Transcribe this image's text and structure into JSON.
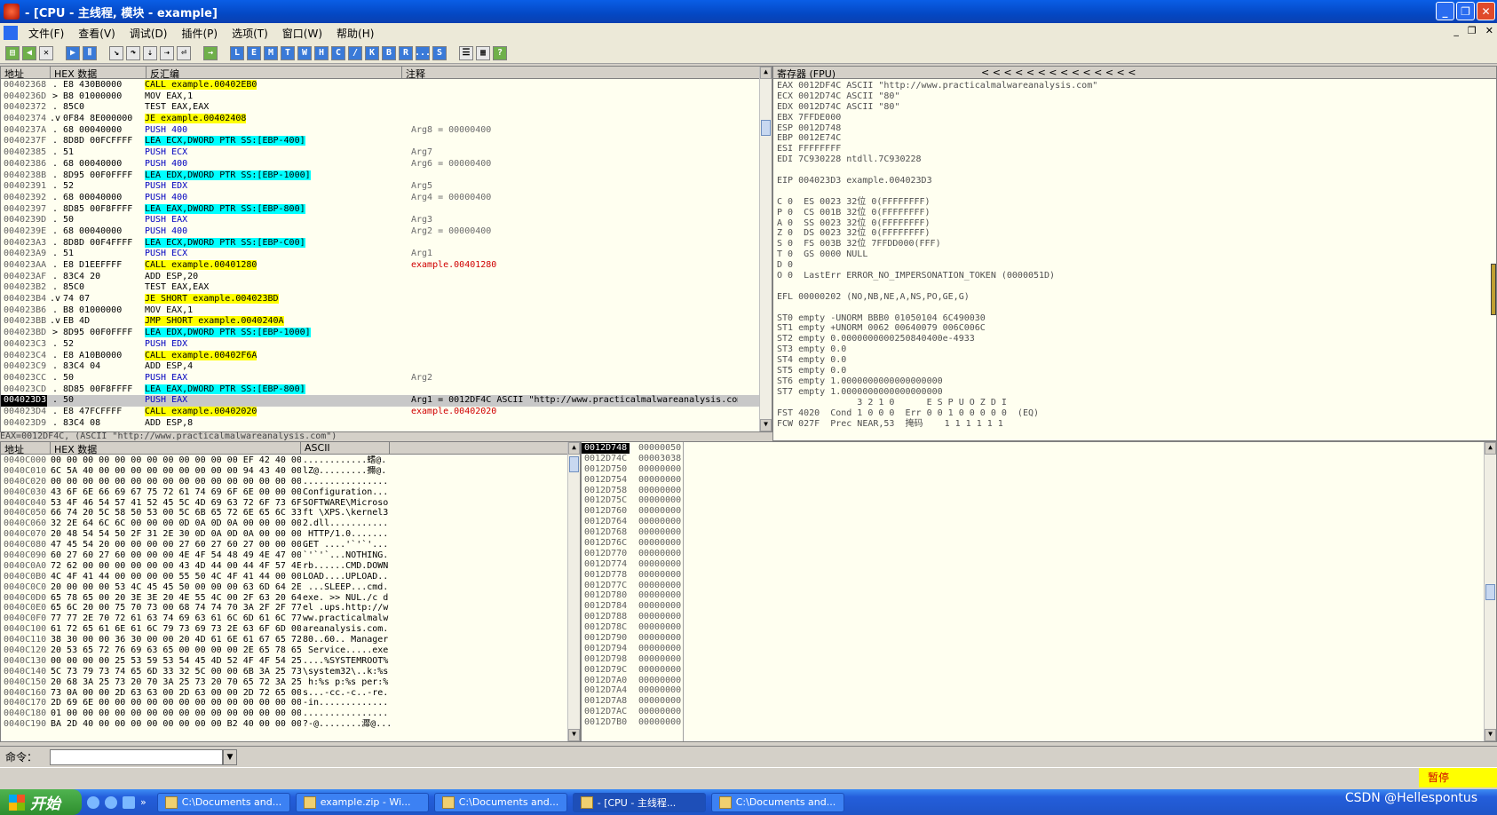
{
  "window": {
    "title": "- [CPU - 主线程, 模块 - example]"
  },
  "menu": [
    "文件(F)",
    "查看(V)",
    "调试(D)",
    "插件(P)",
    "选项(T)",
    "窗口(W)",
    "帮助(H)"
  ],
  "toolbar": [
    "L",
    "E",
    "M",
    "T",
    "W",
    "H",
    "C",
    "/",
    "K",
    "B",
    "R",
    "...",
    "S"
  ],
  "disasm": {
    "headers": {
      "addr": "地址",
      "hex": "HEX 数据",
      "asm": "反汇编",
      "comment": "注释"
    },
    "rows": [
      {
        "a": "00402368",
        "m": ".",
        "h": "E8 430B0000",
        "i": "CALL example.00402EB0",
        "hl": "y",
        "c": ""
      },
      {
        "a": "0040236D",
        "m": ">",
        "h": "B8 01000000",
        "i": "MOV EAX,1",
        "hl": "",
        "c": ""
      },
      {
        "a": "00402372",
        "m": ".",
        "h": "85C0",
        "i": "TEST EAX,EAX",
        "hl": "",
        "c": ""
      },
      {
        "a": "00402374",
        "m": ".v",
        "h": "0F84 8E000000",
        "i": "JE example.00402408",
        "hl": "y",
        "c": ""
      },
      {
        "a": "0040237A",
        "m": ".",
        "h": "68 00040000",
        "i": "PUSH 400",
        "hl": "p",
        "c": "Arg8 = 00000400"
      },
      {
        "a": "0040237F",
        "m": ".",
        "h": "8D8D 00FCFFFF",
        "i": "LEA ECX,DWORD PTR SS:[EBP-400]",
        "hl": "c",
        "c": ""
      },
      {
        "a": "00402385",
        "m": ".",
        "h": "51",
        "i": "PUSH ECX",
        "hl": "p",
        "c": "Arg7"
      },
      {
        "a": "00402386",
        "m": ".",
        "h": "68 00040000",
        "i": "PUSH 400",
        "hl": "p",
        "c": "Arg6 = 00000400"
      },
      {
        "a": "0040238B",
        "m": ".",
        "h": "8D95 00F0FFFF",
        "i": "LEA EDX,DWORD PTR SS:[EBP-1000]",
        "hl": "c",
        "c": ""
      },
      {
        "a": "00402391",
        "m": ".",
        "h": "52",
        "i": "PUSH EDX",
        "hl": "p",
        "c": "Arg5"
      },
      {
        "a": "00402392",
        "m": ".",
        "h": "68 00040000",
        "i": "PUSH 400",
        "hl": "p",
        "c": "Arg4 = 00000400"
      },
      {
        "a": "00402397",
        "m": ".",
        "h": "8D85 00F8FFFF",
        "i": "LEA EAX,DWORD PTR SS:[EBP-800]",
        "hl": "c",
        "c": ""
      },
      {
        "a": "0040239D",
        "m": ".",
        "h": "50",
        "i": "PUSH EAX",
        "hl": "p",
        "c": "Arg3"
      },
      {
        "a": "0040239E",
        "m": ".",
        "h": "68 00040000",
        "i": "PUSH 400",
        "hl": "p",
        "c": "Arg2 = 00000400"
      },
      {
        "a": "004023A3",
        "m": ".",
        "h": "8D8D 00F4FFFF",
        "i": "LEA ECX,DWORD PTR SS:[EBP-C00]",
        "hl": "c",
        "c": ""
      },
      {
        "a": "004023A9",
        "m": ".",
        "h": "51",
        "i": "PUSH ECX",
        "hl": "p",
        "c": "Arg1"
      },
      {
        "a": "004023AA",
        "m": ".",
        "h": "E8 D1EEFFFF",
        "i": "CALL example.00401280",
        "hl": "y",
        "c": "example.00401280"
      },
      {
        "a": "004023AF",
        "m": ".",
        "h": "83C4 20",
        "i": "ADD ESP,20",
        "hl": "",
        "c": ""
      },
      {
        "a": "004023B2",
        "m": ".",
        "h": "85C0",
        "i": "TEST EAX,EAX",
        "hl": "",
        "c": ""
      },
      {
        "a": "004023B4",
        "m": ".v",
        "h": "74 07",
        "i": "JE SHORT example.004023BD",
        "hl": "y",
        "c": ""
      },
      {
        "a": "004023B6",
        "m": ".",
        "h": "B8 01000000",
        "i": "MOV EAX,1",
        "hl": "",
        "c": ""
      },
      {
        "a": "004023BB",
        "m": ".v",
        "h": "EB 4D",
        "i": "JMP SHORT example.0040240A",
        "hl": "y",
        "c": ""
      },
      {
        "a": "004023BD",
        "m": ">",
        "h": "8D95 00F0FFFF",
        "i": "LEA EDX,DWORD PTR SS:[EBP-1000]",
        "hl": "c",
        "c": ""
      },
      {
        "a": "004023C3",
        "m": ".",
        "h": "52",
        "i": "PUSH EDX",
        "hl": "p",
        "c": ""
      },
      {
        "a": "004023C4",
        "m": ".",
        "h": "E8 A10B0000",
        "i": "CALL example.00402F6A",
        "hl": "y",
        "c": ""
      },
      {
        "a": "004023C9",
        "m": ".",
        "h": "83C4 04",
        "i": "ADD ESP,4",
        "hl": "",
        "c": ""
      },
      {
        "a": "004023CC",
        "m": ".",
        "h": "50",
        "i": "PUSH EAX",
        "hl": "p",
        "c": "Arg2"
      },
      {
        "a": "004023CD",
        "m": ".",
        "h": "8D85 00F8FFFF",
        "i": "LEA EAX,DWORD PTR SS:[EBP-800]",
        "hl": "c",
        "c": ""
      },
      {
        "a": "004023D3",
        "m": ".",
        "h": "50",
        "i": "PUSH EAX",
        "hl": "p",
        "c": "Arg1 = 0012DF4C ASCII \"http://www.practicalmalwareanalysis.com\"",
        "cur": true
      },
      {
        "a": "004023D4",
        "m": ".",
        "h": "E8 47FCFFFF",
        "i": "CALL example.00402020",
        "hl": "y",
        "c": "example.00402020"
      },
      {
        "a": "004023D9",
        "m": ".",
        "h": "83C4 08",
        "i": "ADD ESP,8",
        "hl": "",
        "c": ""
      }
    ],
    "info": "EAX=0012DF4C, (ASCII \"http://www.practicalmalwareanalysis.com\")"
  },
  "registers": {
    "header": "寄存器 (FPU)",
    "arrows": "< < < < < < < < < < < < < <",
    "lines": [
      {
        "t": "EAX 0012DF4C ASCII \"http://www.practicalmalwareanalysis.com\"",
        "r": true
      },
      {
        "t": "ECX 0012D74C ASCII \"80\"",
        "r": false
      },
      {
        "t": "EDX 0012D74C ASCII \"80\"",
        "r": false
      },
      {
        "t": "EBX 7FFDE000",
        "r": false
      },
      {
        "t": "ESP 0012D748",
        "r": false
      },
      {
        "t": "EBP 0012E74C",
        "r": false
      },
      {
        "t": "ESI FFFFFFFF",
        "r": false
      },
      {
        "t": "EDI 7C930228 ntdll.7C930228",
        "r": false
      },
      {
        "t": "",
        "r": false
      },
      {
        "t": "EIP 004023D3 example.004023D3",
        "r": true
      },
      {
        "t": "",
        "r": false
      },
      {
        "t": "C 0  ES 0023 32位 0(FFFFFFFF)",
        "r": false
      },
      {
        "t": "P 0  CS 001B 32位 0(FFFFFFFF)",
        "r": false
      },
      {
        "t": "A 0  SS 0023 32位 0(FFFFFFFF)",
        "r": false
      },
      {
        "t": "Z 0  DS 0023 32位 0(FFFFFFFF)",
        "r": false
      },
      {
        "t": "S 0  FS 003B 32位 7FFDD000(FFF)",
        "r": false
      },
      {
        "t": "T 0  GS 0000 NULL",
        "r": false
      },
      {
        "t": "D 0",
        "r": false
      },
      {
        "t": "O 0  LastErr ERROR_NO_IMPERSONATION_TOKEN (0000051D)",
        "r": false
      },
      {
        "t": "",
        "r": false
      },
      {
        "t": "EFL 00000202 (NO,NB,NE,A,NS,PO,GE,G)",
        "r": false
      },
      {
        "t": "",
        "r": false
      },
      {
        "t": "ST0 empty -UNORM BBB0 01050104 6C490030",
        "r": false
      },
      {
        "t": "ST1 empty +UNORM 0062 00640079 006C006C",
        "r": false
      },
      {
        "t": "ST2 empty 0.0000000000250840400e-4933",
        "r": false
      },
      {
        "t": "ST3 empty 0.0",
        "r": false
      },
      {
        "t": "ST4 empty 0.0",
        "r": false
      },
      {
        "t": "ST5 empty 0.0",
        "r": false
      },
      {
        "t": "ST6 empty 1.0000000000000000000",
        "r": false
      },
      {
        "t": "ST7 empty 1.0000000000000000000",
        "r": false
      },
      {
        "t": "               3 2 1 0      E S P U O Z D I",
        "r": false
      },
      {
        "t": "FST 4020  Cond 1 0 0 0  Err 0 0 1 0 0 0 0 0  (EQ)",
        "r": false
      },
      {
        "t": "FCW 027F  Prec NEAR,53  掩码    1 1 1 1 1 1",
        "r": false
      }
    ]
  },
  "dump": {
    "headers": {
      "addr": "地址",
      "hex": "HEX 数据",
      "ascii": "ASCII"
    },
    "rows": [
      {
        "a": "0040C000",
        "h": "00 00 00 00 00 00 00 00 00 00 00 00 EF 42 40 00",
        "s": "............螧@."
      },
      {
        "a": "0040C010",
        "h": "6C 5A 40 00 00 00 00 00 00 00 00 00 94 43 40 00",
        "s": "lZ@.........擟@."
      },
      {
        "a": "0040C020",
        "h": "00 00 00 00 00 00 00 00 00 00 00 00 00 00 00 00",
        "s": "................"
      },
      {
        "a": "0040C030",
        "h": "43 6F 6E 66 69 67 75 72 61 74 69 6F 6E 00 00 00",
        "s": "Configuration..."
      },
      {
        "a": "0040C040",
        "h": "53 4F 46 54 57 41 52 45 5C 4D 69 63 72 6F 73 6F",
        "s": "SOFTWARE\\Microso"
      },
      {
        "a": "0040C050",
        "h": "66 74 20 5C 58 50 53 00 5C 6B 65 72 6E 65 6C 33",
        "s": "ft \\XPS.\\kernel3"
      },
      {
        "a": "0040C060",
        "h": "32 2E 64 6C 6C 00 00 00 0D 0A 0D 0A 00 00 00 00",
        "s": "2.dll..........."
      },
      {
        "a": "0040C070",
        "h": "20 48 54 54 50 2F 31 2E 30 0D 0A 0D 0A 00 00 00",
        "s": " HTTP/1.0......."
      },
      {
        "a": "0040C080",
        "h": "47 45 54 20 00 00 00 00 27 60 27 60 27 00 00 00",
        "s": "GET ....'`'`'..."
      },
      {
        "a": "0040C090",
        "h": "60 27 60 27 60 00 00 00 4E 4F 54 48 49 4E 47 00",
        "s": "`'`'`...NOTHING."
      },
      {
        "a": "0040C0A0",
        "h": "72 62 00 00 00 00 00 00 43 4D 44 00 44 4F 57 4E",
        "s": "rb......CMD.DOWN"
      },
      {
        "a": "0040C0B0",
        "h": "4C 4F 41 44 00 00 00 00 55 50 4C 4F 41 44 00 00",
        "s": "LOAD....UPLOAD.."
      },
      {
        "a": "0040C0C0",
        "h": "20 00 00 00 53 4C 45 45 50 00 00 00 63 6D 64 2E",
        "s": " ...SLEEP...cmd."
      },
      {
        "a": "0040C0D0",
        "h": "65 78 65 00 20 3E 3E 20 4E 55 4C 00 2F 63 20 64",
        "s": "exe. >> NUL./c d"
      },
      {
        "a": "0040C0E0",
        "h": "65 6C 20 00 75 70 73 00 68 74 74 70 3A 2F 2F 77",
        "s": "el .ups.http://w"
      },
      {
        "a": "0040C0F0",
        "h": "77 77 2E 70 72 61 63 74 69 63 61 6C 6D 61 6C 77",
        "s": "ww.practicalmalw"
      },
      {
        "a": "0040C100",
        "h": "61 72 65 61 6E 61 6C 79 73 69 73 2E 63 6F 6D 00",
        "s": "areanalysis.com."
      },
      {
        "a": "0040C110",
        "h": "38 30 00 00 36 30 00 00 20 4D 61 6E 61 67 65 72",
        "s": "80..60.. Manager"
      },
      {
        "a": "0040C120",
        "h": "20 53 65 72 76 69 63 65 00 00 00 00 2E 65 78 65",
        "s": " Service.....exe"
      },
      {
        "a": "0040C130",
        "h": "00 00 00 00 25 53 59 53 54 45 4D 52 4F 4F 54 25",
        "s": "....%SYSTEMROOT%"
      },
      {
        "a": "0040C140",
        "h": "5C 73 79 73 74 65 6D 33 32 5C 00 00 6B 3A 25 73",
        "s": "\\system32\\..k:%s"
      },
      {
        "a": "0040C150",
        "h": "20 68 3A 25 73 20 70 3A 25 73 20 70 65 72 3A 25",
        "s": " h:%s p:%s per:%"
      },
      {
        "a": "0040C160",
        "h": "73 0A 00 00 2D 63 63 00 2D 63 00 00 2D 72 65 00",
        "s": "s...-cc.-c..-re."
      },
      {
        "a": "0040C170",
        "h": "2D 69 6E 00 00 00 00 00 00 00 00 00 00 00 00 00",
        "s": "-in............."
      },
      {
        "a": "0040C180",
        "h": "01 00 00 00 00 00 00 00 00 00 00 00 00 00 00 00",
        "s": "................"
      },
      {
        "a": "0040C190",
        "h": "BA 2D 40 00 00 00 00 00 00 00 00 B2 40 00 00 00",
        "s": "?-@........灖@..."
      }
    ]
  },
  "stack": {
    "rows": [
      {
        "a": "0012D748",
        "v": "00000050",
        "sel": true
      },
      {
        "a": "0012D74C",
        "v": "00003038"
      },
      {
        "a": "0012D750",
        "v": "00000000"
      },
      {
        "a": "0012D754",
        "v": "00000000"
      },
      {
        "a": "0012D758",
        "v": "00000000"
      },
      {
        "a": "0012D75C",
        "v": "00000000"
      },
      {
        "a": "0012D760",
        "v": "00000000"
      },
      {
        "a": "0012D764",
        "v": "00000000"
      },
      {
        "a": "0012D768",
        "v": "00000000"
      },
      {
        "a": "0012D76C",
        "v": "00000000"
      },
      {
        "a": "0012D770",
        "v": "00000000"
      },
      {
        "a": "0012D774",
        "v": "00000000"
      },
      {
        "a": "0012D778",
        "v": "00000000"
      },
      {
        "a": "0012D77C",
        "v": "00000000"
      },
      {
        "a": "0012D780",
        "v": "00000000"
      },
      {
        "a": "0012D784",
        "v": "00000000"
      },
      {
        "a": "0012D788",
        "v": "00000000"
      },
      {
        "a": "0012D78C",
        "v": "00000000"
      },
      {
        "a": "0012D790",
        "v": "00000000"
      },
      {
        "a": "0012D794",
        "v": "00000000"
      },
      {
        "a": "0012D798",
        "v": "00000000"
      },
      {
        "a": "0012D79C",
        "v": "00000000"
      },
      {
        "a": "0012D7A0",
        "v": "00000000"
      },
      {
        "a": "0012D7A4",
        "v": "00000000"
      },
      {
        "a": "0012D7A8",
        "v": "00000000"
      },
      {
        "a": "0012D7AC",
        "v": "00000000"
      },
      {
        "a": "0012D7B0",
        "v": "00000000"
      }
    ]
  },
  "command": {
    "label": "命令：",
    "value": ""
  },
  "status": {
    "state": "暂停"
  },
  "taskbar": {
    "start": "开始",
    "tasks": [
      {
        "label": "C:\\Documents and...",
        "active": false
      },
      {
        "label": "example.zip - Wi...",
        "active": false
      },
      {
        "label": "C:\\Documents and...",
        "active": false
      },
      {
        "label": "- [CPU - 主线程...",
        "active": true
      },
      {
        "label": "C:\\Documents and...",
        "active": false
      }
    ]
  },
  "watermark": "CSDN @Hellespontus",
  "colors": {
    "yellow": "#ffff00",
    "cyan": "#00ffff",
    "push_blue": "#0000c0",
    "red": "#d00000"
  }
}
